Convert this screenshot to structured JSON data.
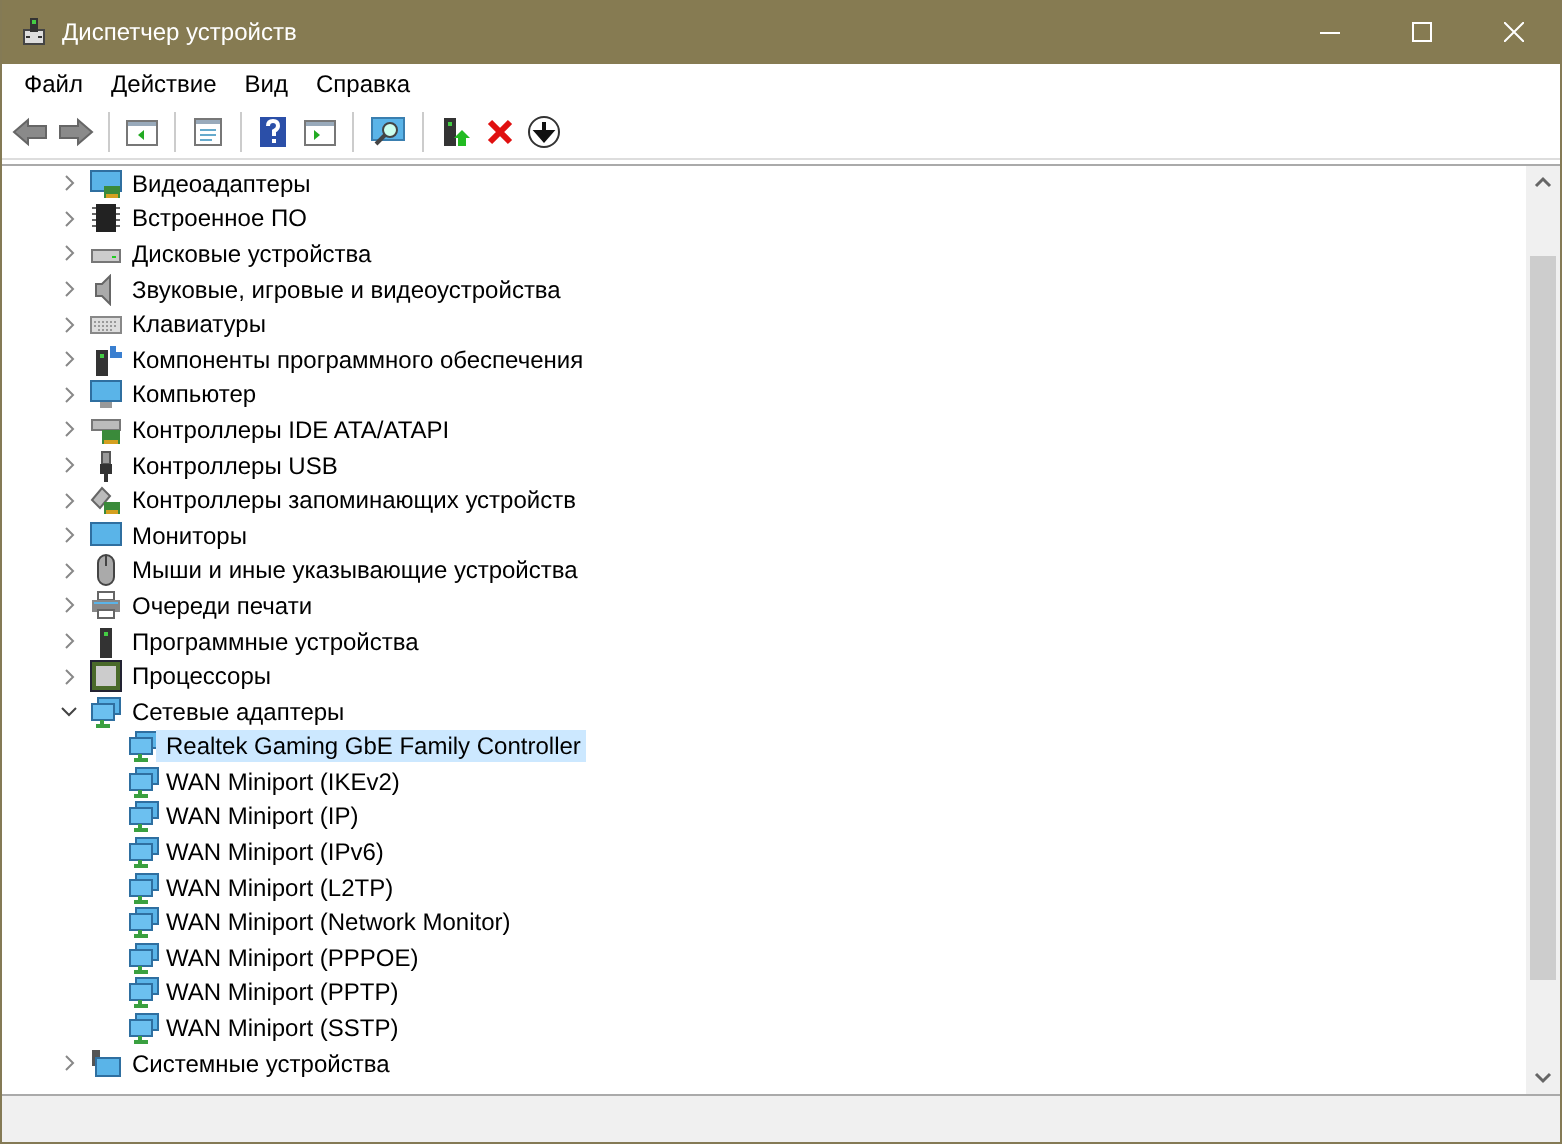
{
  "window": {
    "title": "Диспетчер устройств"
  },
  "menu": [
    "Файл",
    "Действие",
    "Вид",
    "Справка"
  ],
  "tree": [
    {
      "label": "Видеоадаптеры",
      "expanded": false
    },
    {
      "label": "Встроенное ПО",
      "expanded": false
    },
    {
      "label": "Дисковые устройства",
      "expanded": false
    },
    {
      "label": "Звуковые, игровые и видеоустройства",
      "expanded": false
    },
    {
      "label": "Клавиатуры",
      "expanded": false
    },
    {
      "label": "Компоненты программного обеспечения",
      "expanded": false
    },
    {
      "label": "Компьютер",
      "expanded": false
    },
    {
      "label": "Контроллеры IDE ATA/ATAPI",
      "expanded": false
    },
    {
      "label": "Контроллеры USB",
      "expanded": false
    },
    {
      "label": "Контроллеры запоминающих устройств",
      "expanded": false
    },
    {
      "label": "Мониторы",
      "expanded": false
    },
    {
      "label": "Мыши и иные указывающие устройства",
      "expanded": false
    },
    {
      "label": "Очереди печати",
      "expanded": false
    },
    {
      "label": "Программные устройства",
      "expanded": false
    },
    {
      "label": "Процессоры",
      "expanded": false
    },
    {
      "label": "Сетевые адаптеры",
      "expanded": true,
      "children": [
        {
          "label": "Realtek Gaming GbE Family Controller",
          "selected": true
        },
        {
          "label": "WAN Miniport (IKEv2)",
          "selected": false
        },
        {
          "label": "WAN Miniport (IP)",
          "selected": false
        },
        {
          "label": "WAN Miniport (IPv6)",
          "selected": false
        },
        {
          "label": "WAN Miniport (L2TP)",
          "selected": false
        },
        {
          "label": "WAN Miniport (Network Monitor)",
          "selected": false
        },
        {
          "label": "WAN Miniport (PPPOE)",
          "selected": false
        },
        {
          "label": "WAN Miniport (PPTP)",
          "selected": false
        },
        {
          "label": "WAN Miniport (SSTP)",
          "selected": false
        }
      ]
    },
    {
      "label": "Системные устройства",
      "expanded": false
    }
  ]
}
